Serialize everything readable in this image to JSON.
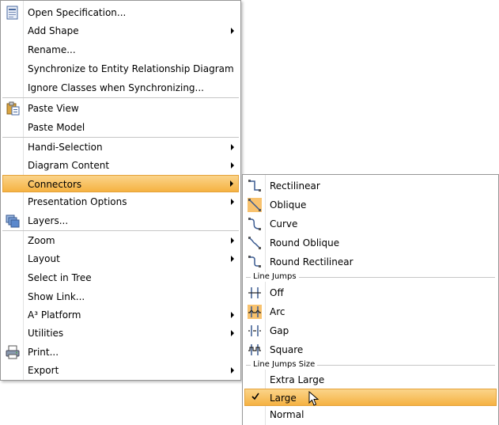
{
  "main_menu": {
    "items": [
      {
        "label": "Open Specification...",
        "icon": "specification-icon"
      },
      {
        "label": "Add Shape",
        "submenu": true
      },
      {
        "label": "Rename..."
      },
      {
        "label": "Synchronize to Entity Relationship Diagram"
      },
      {
        "label": "Ignore Classes when Synchronizing..."
      },
      {
        "label": "Paste View",
        "icon": "paste-icon"
      },
      {
        "label": "Paste Model"
      },
      {
        "label": "Handi-Selection",
        "submenu": true
      },
      {
        "label": "Diagram Content",
        "submenu": true
      },
      {
        "label": "Connectors",
        "submenu": true,
        "highlighted": true
      },
      {
        "label": "Presentation Options",
        "submenu": true
      },
      {
        "label": "Layers...",
        "icon": "layers-icon"
      },
      {
        "label": "Zoom",
        "submenu": true
      },
      {
        "label": "Layout",
        "submenu": true
      },
      {
        "label": "Select in Tree"
      },
      {
        "label": "Show Link..."
      },
      {
        "label": "A³ Platform",
        "submenu": true
      },
      {
        "label": "Utilities",
        "submenu": true
      },
      {
        "label": "Print...",
        "icon": "printer-icon"
      },
      {
        "label": "Export",
        "submenu": true
      }
    ]
  },
  "connectors_submenu": {
    "styles": [
      {
        "label": "Rectilinear",
        "icon": "rectilinear-connector-icon"
      },
      {
        "label": "Oblique",
        "icon": "oblique-connector-icon",
        "selected": true
      },
      {
        "label": "Curve",
        "icon": "curve-connector-icon"
      },
      {
        "label": "Round Oblique",
        "icon": "round-oblique-connector-icon"
      },
      {
        "label": "Round Rectilinear",
        "icon": "round-rectilinear-connector-icon"
      }
    ],
    "line_jumps_header": "Line Jumps",
    "line_jumps": [
      {
        "label": "Off",
        "icon": "line-jump-off-icon"
      },
      {
        "label": "Arc",
        "icon": "line-jump-arc-icon",
        "selected": true
      },
      {
        "label": "Gap",
        "icon": "line-jump-gap-icon"
      },
      {
        "label": "Square",
        "icon": "line-jump-square-icon"
      }
    ],
    "line_jumps_size_header": "Line Jumps Size",
    "sizes": [
      {
        "label": "Extra Large"
      },
      {
        "label": "Large",
        "checked": true,
        "highlighted": true
      },
      {
        "label": "Normal"
      }
    ]
  },
  "colors": {
    "highlight_top": "#fbd48a",
    "highlight_bottom": "#f5b242",
    "selected_icon_bg": "#f8c26e"
  }
}
